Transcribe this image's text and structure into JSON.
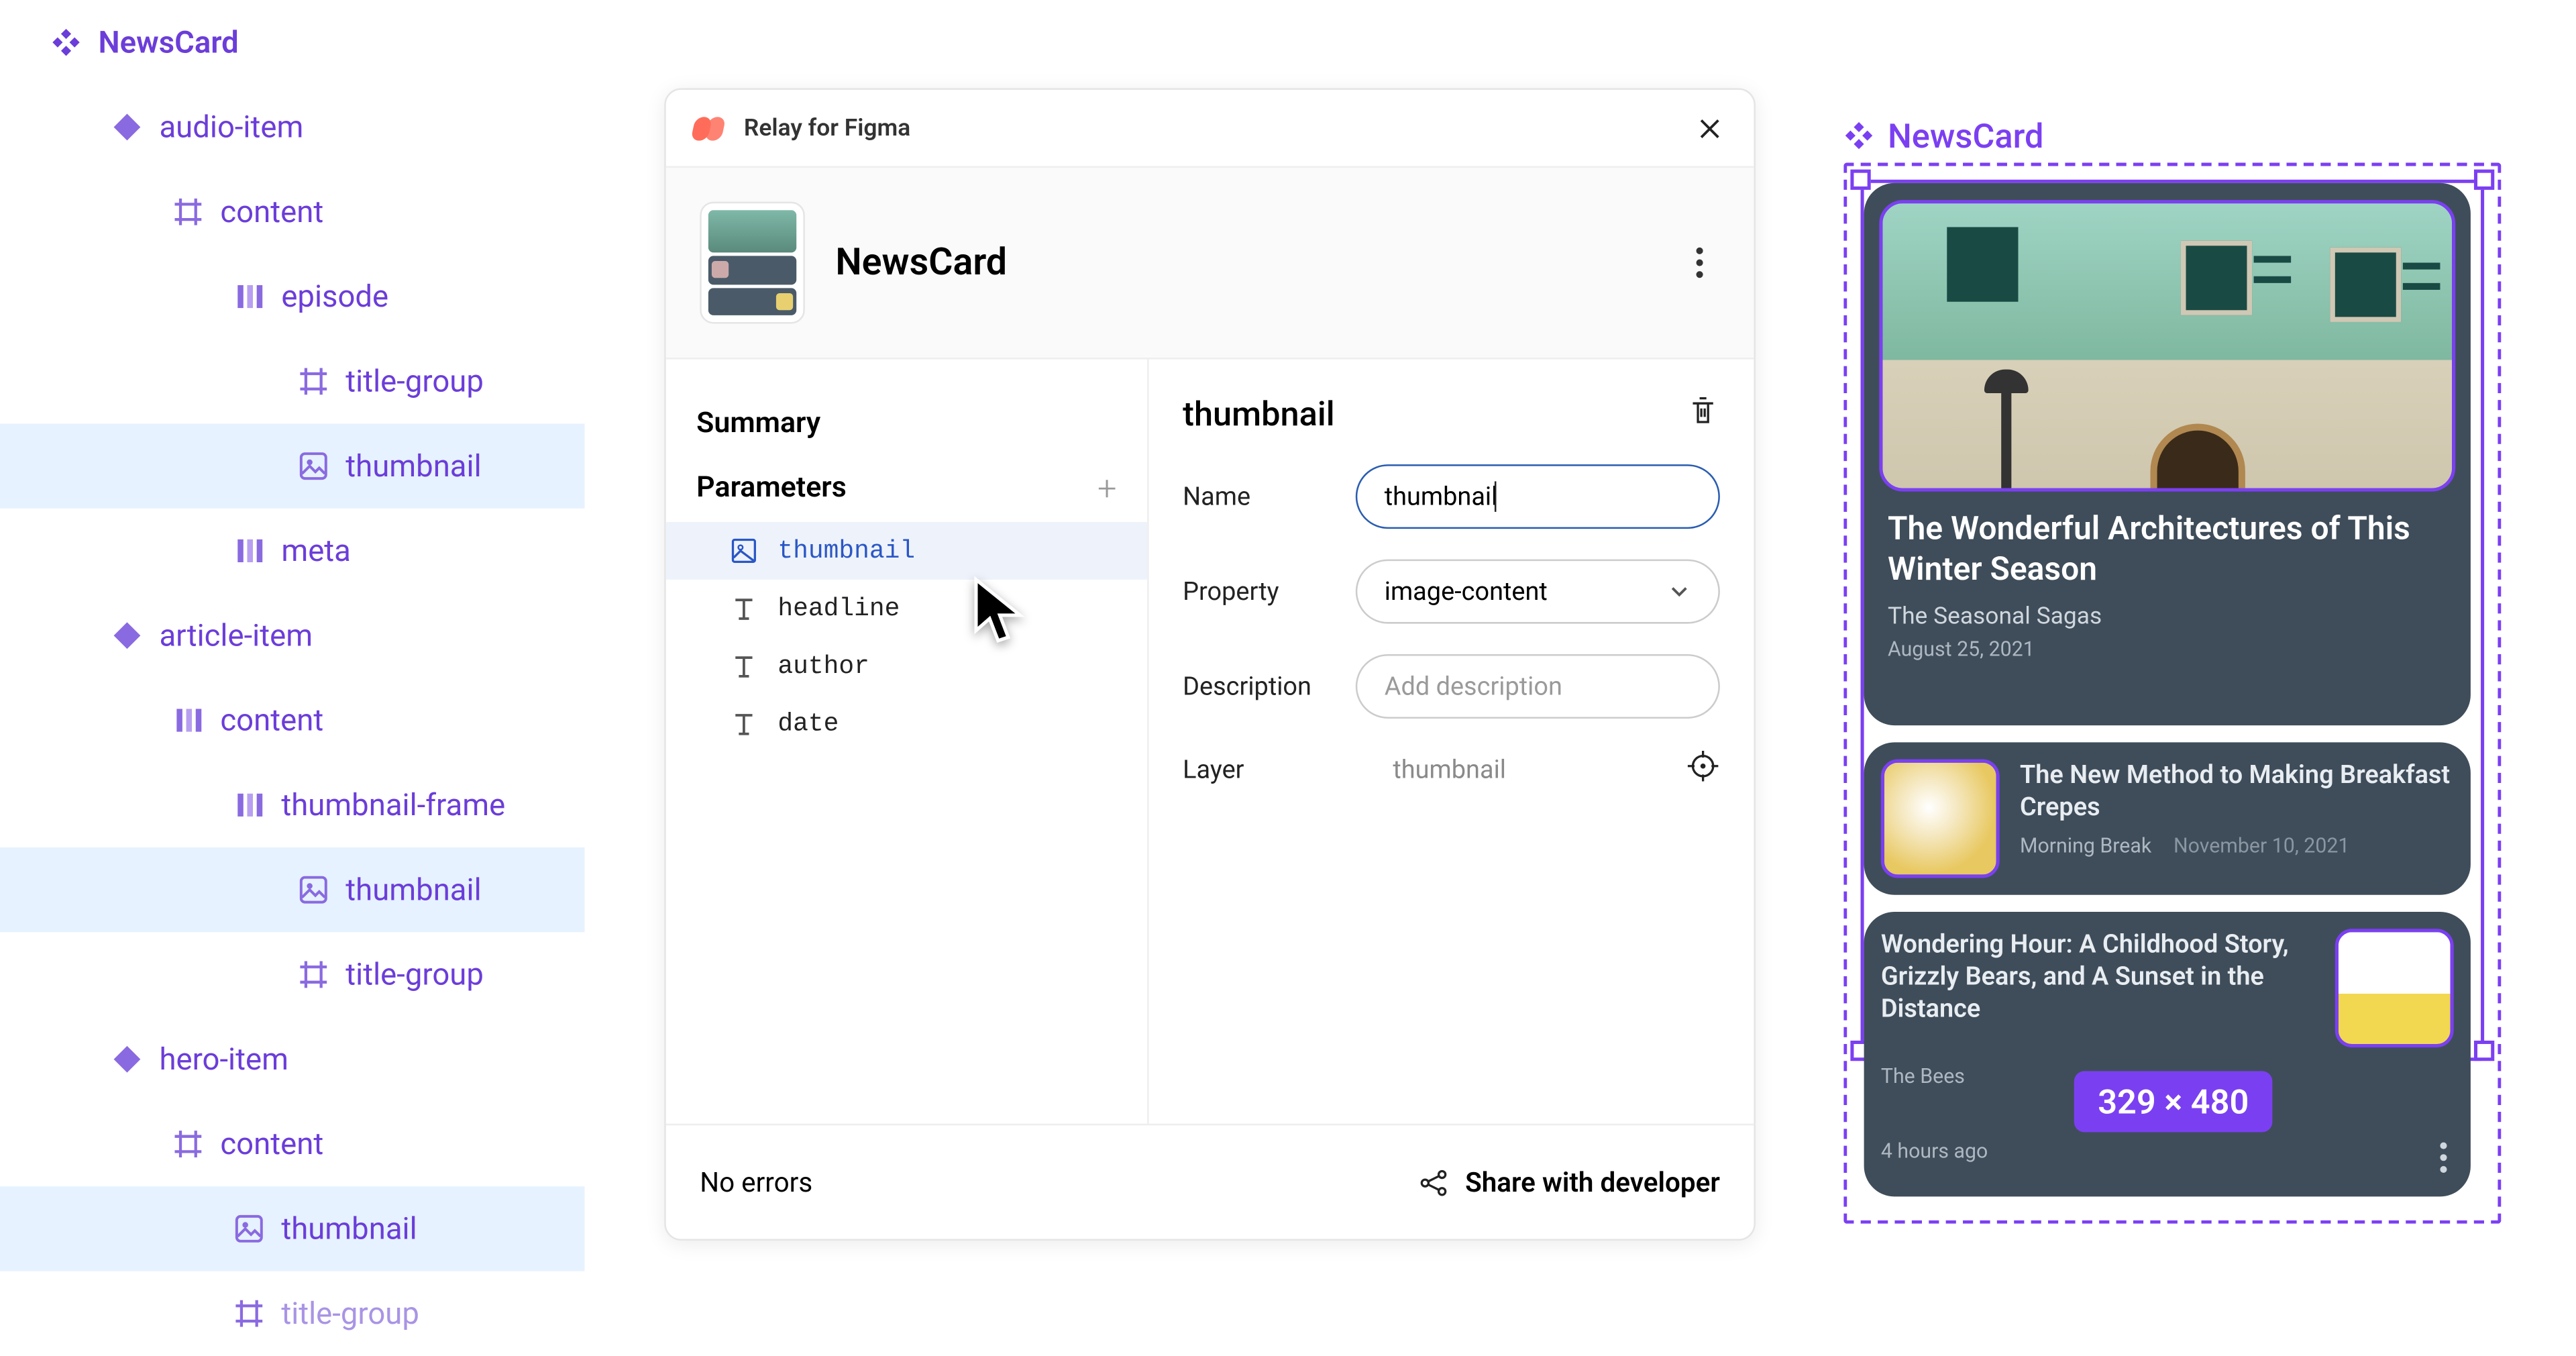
{
  "tree": {
    "root": "NewsCard",
    "items": [
      {
        "label": "audio-item",
        "type": "diamond",
        "indent": 1
      },
      {
        "label": "content",
        "type": "frame",
        "indent": 2
      },
      {
        "label": "episode",
        "type": "dots",
        "indent": 3
      },
      {
        "label": "title-group",
        "type": "frame",
        "indent": 4
      },
      {
        "label": "thumbnail",
        "type": "image",
        "indent": 4,
        "selected": true
      },
      {
        "label": "meta",
        "type": "dots",
        "indent": 3
      },
      {
        "label": "article-item",
        "type": "diamond",
        "indent": 1
      },
      {
        "label": "content",
        "type": "dots",
        "indent": 2
      },
      {
        "label": "thumbnail-frame",
        "type": "dots",
        "indent": 3
      },
      {
        "label": "thumbnail",
        "type": "image",
        "indent": 4,
        "selected": true
      },
      {
        "label": "title-group",
        "type": "frame",
        "indent": 4
      },
      {
        "label": "hero-item",
        "type": "diamond",
        "indent": 1
      },
      {
        "label": "content",
        "type": "frame",
        "indent": 2
      },
      {
        "label": "thumbnail",
        "type": "image",
        "indent": 3,
        "selected": true
      },
      {
        "label": "title-group",
        "type": "frame",
        "indent": 3,
        "dim": true
      }
    ]
  },
  "panel": {
    "plugin_title": "Relay for Figma",
    "component_name": "NewsCard",
    "left": {
      "summary_label": "Summary",
      "parameters_label": "Parameters",
      "params": [
        {
          "label": "thumbnail",
          "icon": "image",
          "active": true
        },
        {
          "label": "headline",
          "icon": "text"
        },
        {
          "label": "author",
          "icon": "text"
        },
        {
          "label": "date",
          "icon": "text"
        }
      ]
    },
    "right": {
      "heading": "thumbnail",
      "name_label": "Name",
      "name_value": "thumbnail",
      "property_label": "Property",
      "property_value": "image-content",
      "description_label": "Description",
      "description_placeholder": "Add description",
      "layer_label": "Layer",
      "layer_value": "thumbnail"
    },
    "footer": {
      "errors": "No errors",
      "share": "Share with developer"
    }
  },
  "artboard": {
    "label": "NewsCard",
    "dimensions": "329 × 480",
    "hero": {
      "title": "The Wonderful Architectures of This Winter Season",
      "author": "The Seasonal Sagas",
      "date": "August 25, 2021"
    },
    "item1": {
      "title": "The New Method to Making Breakfast Crepes",
      "author": "Morning Break",
      "date": "November 10, 2021"
    },
    "item2": {
      "title": "Wondering Hour: A Childhood Story, Grizzly Bears, and A Sunset in the Distance",
      "author": "The Bees",
      "date": "4 hours ago"
    }
  }
}
